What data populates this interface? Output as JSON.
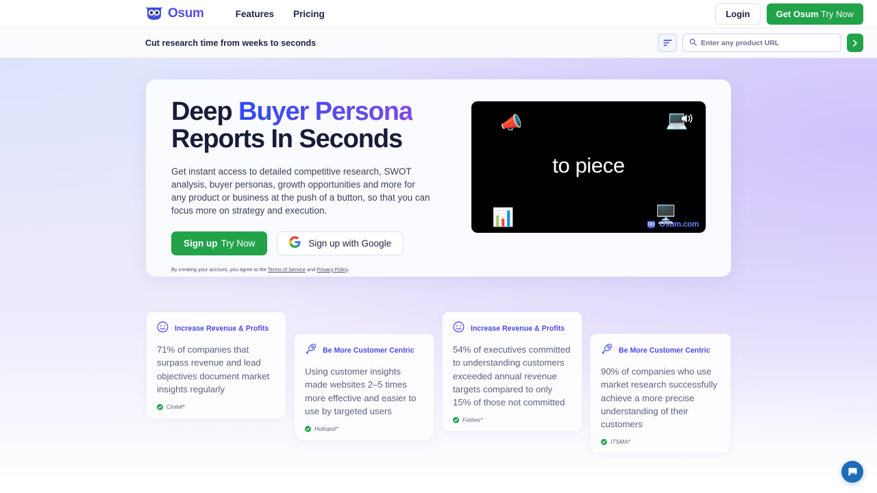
{
  "nav": {
    "brand": "Osum",
    "brand_icon": "owl-logo-icon",
    "links": [
      {
        "label": "Features"
      },
      {
        "label": "Pricing"
      }
    ],
    "login_label": "Login",
    "cta_bold": "Get Osum",
    "cta_light": "Try Now"
  },
  "subbar": {
    "tagline": "Cut research time from weeks to seconds",
    "filter_icon": "filter-icon",
    "search_icon": "search-icon",
    "search_placeholder": "Enter any product URL",
    "search_value": "",
    "go_icon": "chevron-right-icon"
  },
  "hero": {
    "heading_part1": "Deep ",
    "heading_highlight": "Buyer Persona",
    "heading_part2": "Reports In Seconds",
    "paragraph": "Get instant access to detailed competitive research, SWOT analysis, buyer personas, growth opportunities and more for any product or business at the push of a button, so that you can focus more on strategy and execution.",
    "signup_bold": "Sign up",
    "signup_light": "Try Now",
    "google_label": "Sign up with Google",
    "google_icon": "google-g-icon",
    "legal_prefix": "By creating your account, you agree to the ",
    "legal_terms": "Terms of Service",
    "legal_and": " and ",
    "legal_privacy": "Privacy Policy",
    "legal_suffix": "."
  },
  "video": {
    "caption": "to piece",
    "sound_icon": "speaker-on-icon",
    "watermark_text": "Osum.com",
    "watermark_icon": "owl-logo-icon",
    "emojis": [
      "megaphone",
      "laptop-chart",
      "documents-magnifier",
      "monitor-play"
    ]
  },
  "cards": [
    {
      "icon": "smiley-face-icon",
      "title": "Increase Revenue & Profits",
      "body": "71% of companies that surpass revenue and lead objectives document market insights regularly",
      "source": "Cintell*",
      "source_icon": "check-circle-icon"
    },
    {
      "icon": "rocket-icon",
      "title": "Be More Customer Centric",
      "body": "Using customer insights made websites 2–5 times more effective and easier to use by targeted users",
      "source": "Hubspot*",
      "source_icon": "check-circle-icon"
    },
    {
      "icon": "smiley-face-icon",
      "title": "Increase Revenue & Profits",
      "body": "54% of executives committed to understanding customers exceeded annual revenue targets compared to only 15% of those not committed",
      "source": "Forbes*",
      "source_icon": "check-circle-icon"
    },
    {
      "icon": "rocket-icon",
      "title": "Be More Customer Centric",
      "body": "90% of companies who use market research successfully achieve a more precise understanding of their customers",
      "source": "ITSMA*",
      "source_icon": "check-circle-icon"
    }
  ],
  "chat": {
    "icon": "chat-bubble-icon"
  },
  "colors": {
    "green": "#22a34a",
    "brand_blue": "#3b4fe0",
    "brand_purple": "#7d4ae0",
    "card_title": "#4b4ae8",
    "chat_blue": "#1e6bb8"
  }
}
